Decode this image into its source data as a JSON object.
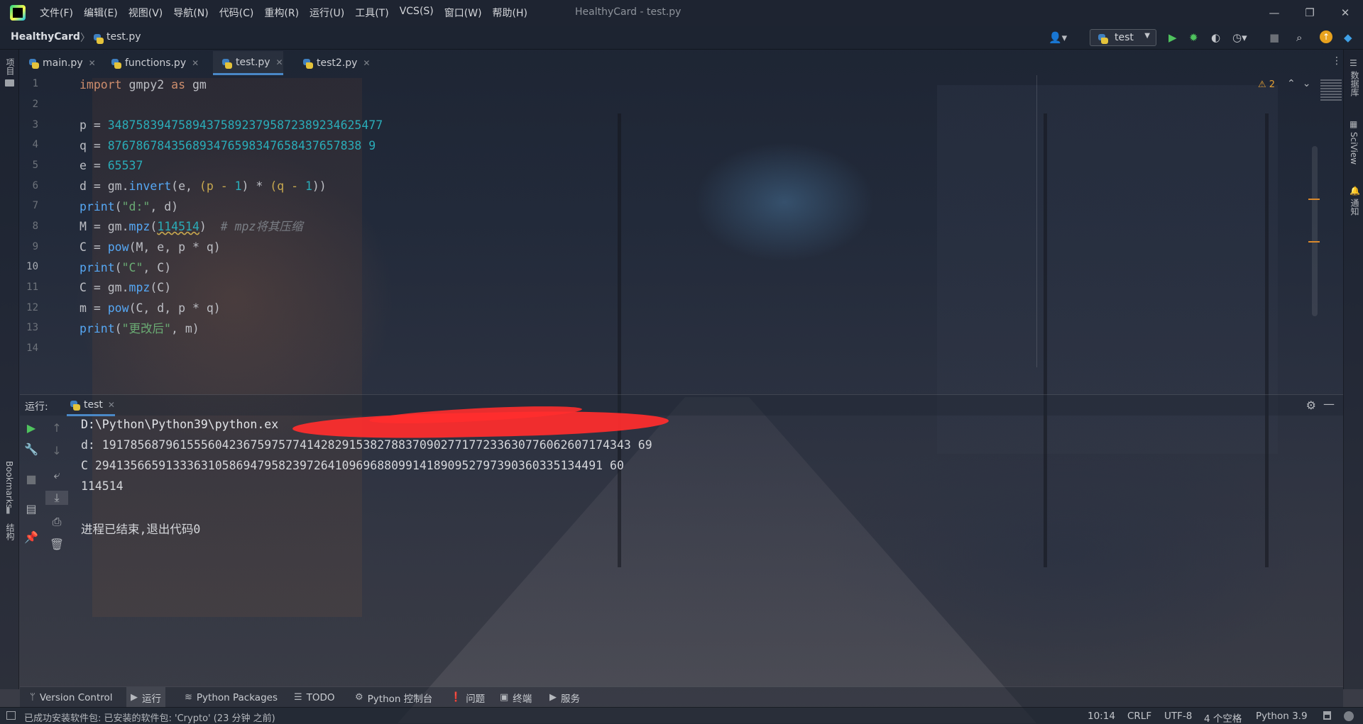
{
  "titlebar": {
    "menu": [
      "文件(F)",
      "编辑(E)",
      "视图(V)",
      "导航(N)",
      "代码(C)",
      "重构(R)",
      "运行(U)",
      "工具(T)",
      "VCS(S)",
      "窗口(W)",
      "帮助(H)"
    ],
    "window_title": "HealthyCard - test.py",
    "controls": {
      "minimize": "—",
      "restore": "❐",
      "close": "✕"
    }
  },
  "navbar": {
    "project": "HealthyCard",
    "separator": "〉",
    "file": "test.py",
    "user_icon": "👤▾",
    "run_config": "test",
    "icons": [
      "run-icon",
      "debug-icon",
      "coverage-icon",
      "profile-icon",
      "stop-icon",
      "search-icon",
      "update-icon",
      "toolbox-icon"
    ]
  },
  "tabs": [
    {
      "label": "main.py",
      "active": false
    },
    {
      "label": "functions.py",
      "active": false
    },
    {
      "label": "test.py",
      "active": true
    },
    {
      "label": "test2.py",
      "active": false
    }
  ],
  "left_stripe": {
    "project": "项目",
    "bookmarks": "Bookmarks",
    "structure": "结构"
  },
  "right_stripe": {
    "database": "数据库",
    "sciview": "SciView",
    "notifications": "通知"
  },
  "editor": {
    "line_numbers": [
      "1",
      "2",
      "3",
      "4",
      "5",
      "6",
      "7",
      "8",
      "9",
      "10",
      "11",
      "12",
      "13",
      "14"
    ],
    "current_line": 10,
    "warnings_count": "2",
    "code": {
      "l1_import": "import",
      "l1_mod": " gmpy2 ",
      "l1_as": "as",
      "l1_alias": " gm",
      "l3_var": "p = ",
      "l3_val": "348758394758943758923795872389234625477",
      "l4_var": "q = ",
      "l4_val": "876786784356893476598347658437657838 9",
      "l5_var": "e = ",
      "l5_val": "65537",
      "l6_a": "d = gm.",
      "l6_f": "invert",
      "l6_b": "(e, ",
      "l6_c": "(p - ",
      "l6_n1": "1",
      "l6_d": ") * ",
      "l6_e": "(q - ",
      "l6_n2": "1",
      "l6_g": "))",
      "l7_f": "print",
      "l7_a": "(",
      "l7_s": "\"d:\"",
      "l7_b": ", d)",
      "l8_a": "M = gm.",
      "l8_f": "mpz",
      "l8_b": "(",
      "l8_n": "114514",
      "l8_c": ")  ",
      "l8_comment": "# mpz将其压缩",
      "l9_a": "C = ",
      "l9_f": "pow",
      "l9_b": "(M, e, p * q)",
      "l10_f": "print",
      "l10_a": "(",
      "l10_s": "\"C\"",
      "l10_b": ", C)",
      "l11_a": "C = gm.",
      "l11_f": "mpz",
      "l11_b": "(C)",
      "l12_a": "m = ",
      "l12_f": "pow",
      "l12_b": "(C, d, p * q)",
      "l13_f": "print",
      "l13_a": "(",
      "l13_s": "\"更改后\"",
      "l13_b": ", m)"
    }
  },
  "run_panel": {
    "title": "运行:",
    "tab": "test",
    "output": [
      "D:\\Python\\Python39\\python.ex",
      "d: 191785687961555604236759757741428291538278837090277177233630776062607174343 69",
      "C 294135665913336310586947958239726410969688099141890952797390360335134491 60",
      "114514",
      "",
      "进程已结束,退出代码0"
    ]
  },
  "bottom_tools": [
    {
      "icon": "ᛘ",
      "label": "Version Control"
    },
    {
      "icon": "▶",
      "label": "运行",
      "active": true
    },
    {
      "icon": "≋",
      "label": "Python Packages"
    },
    {
      "icon": "☰",
      "label": "TODO"
    },
    {
      "icon": "⚙",
      "label": "Python 控制台"
    },
    {
      "icon": "❗",
      "label": "问题"
    },
    {
      "icon": "▣",
      "label": "终端"
    },
    {
      "icon": "▶",
      "label": "服务"
    }
  ],
  "statusbar": {
    "message": "已成功安装软件包: 已安装的软件包: 'Crypto' (23 分钟 之前)",
    "position": "10:14",
    "line_sep": "CRLF",
    "encoding": "UTF-8",
    "indent": "4 个空格",
    "interpreter": "Python 3.9"
  }
}
